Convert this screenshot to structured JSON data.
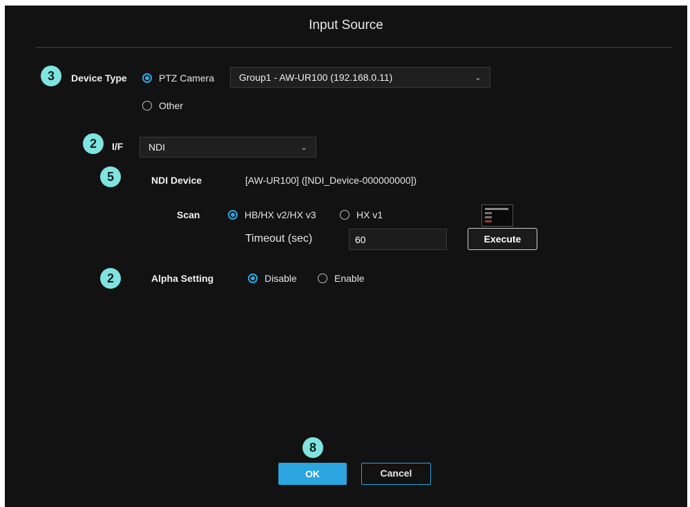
{
  "dialog": {
    "title": "Input Source"
  },
  "badges": {
    "device_type": "3",
    "interface": "2",
    "ndi_device": "5",
    "alpha": "2",
    "ok": "8"
  },
  "device_type": {
    "label": "Device Type",
    "options": [
      {
        "label": "PTZ Camera",
        "selected": true
      },
      {
        "label": "Other",
        "selected": false
      }
    ],
    "camera_select": {
      "value": "Group1 - AW-UR100 (192.168.0.11)"
    }
  },
  "interface": {
    "label": "I/F",
    "value": "NDI"
  },
  "ndi_device": {
    "label": "NDI Device",
    "value": "[AW-UR100] ([NDI_Device-000000000])"
  },
  "scan": {
    "label": "Scan",
    "options": [
      {
        "label": "HB/HX v2/HX v3",
        "selected": true
      },
      {
        "label": "HX v1",
        "selected": false
      }
    ],
    "timeout_label": "Timeout (sec)",
    "timeout_value": "60",
    "execute_label": "Execute"
  },
  "alpha": {
    "label": "Alpha Setting",
    "options": [
      {
        "label": "Disable",
        "selected": true
      },
      {
        "label": "Enable",
        "selected": false
      }
    ]
  },
  "footer": {
    "ok_label": "OK",
    "cancel_label": "Cancel"
  },
  "colors": {
    "accent": "#2aa5df",
    "badge": "#7fe4e0",
    "background": "#121212"
  }
}
